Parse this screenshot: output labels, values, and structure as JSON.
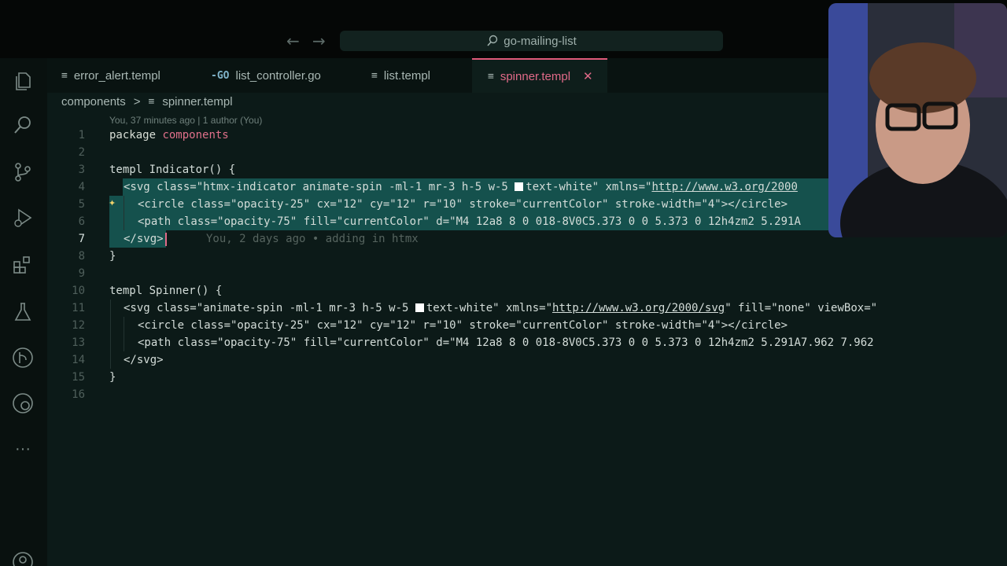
{
  "window": {
    "search_label": "go-mailing-list"
  },
  "tabs": [
    {
      "label": "error_alert.templ",
      "icon": "≡"
    },
    {
      "label": "list_controller.go",
      "icon": "-GO"
    },
    {
      "label": "list.templ",
      "icon": "≡"
    },
    {
      "label": "spinner.templ",
      "icon": "≡",
      "close": "✕"
    }
  ],
  "breadcrumb": {
    "folder": "components",
    "sep": ">",
    "file_icon": "≡",
    "file": "spinner.templ"
  },
  "blame_header": "You, 37 minutes ago | 1 author (You)",
  "inline_blame": "You, 2 days ago • adding in htmx",
  "line_numbers": [
    "1",
    "2",
    "3",
    "4",
    "5",
    "6",
    "7",
    "8",
    "9",
    "10",
    "11",
    "12",
    "13",
    "14",
    "15",
    "16"
  ],
  "code": {
    "l1a": "package ",
    "l1b": "components",
    "l3": "templ Indicator() {",
    "l4a": "<svg class=\"htmx-indicator animate-spin -ml-1 mr-3 h-5 w-5 ",
    "l4b": "text-white\" xmlns=\"",
    "l4c": "http://www.w3.org/2000",
    "l5": "<circle class=\"opacity-25\" cx=\"12\" cy=\"12\" r=\"10\" stroke=\"currentColor\" stroke-width=\"4\"></circle>",
    "l6": "<path class=\"opacity-75\" fill=\"currentColor\" d=\"M4 12a8 8 0 018-8V0C5.373 0 0 5.373 0 12h4zm2 5.291A",
    "l7": "</svg>",
    "l8": "}",
    "l10": "templ Spinner() {",
    "l11a": "<svg class=\"animate-spin -ml-1 mr-3 h-5 w-5 ",
    "l11b": "text-white\" xmlns=\"",
    "l11c": "http://www.w3.org/2000/svg",
    "l11d": "\" fill=\"none\" viewBox=\"",
    "l12": "<circle class=\"opacity-25\" cx=\"12\" cy=\"12\" r=\"10\" stroke=\"currentColor\" stroke-width=\"4\"></circle>",
    "l13": "<path class=\"opacity-75\" fill=\"currentColor\" d=\"M4 12a8 8 0 018-8V0C5.373 0 0 5.373 0 12h4zm2 5.291A7.962 7.962 ",
    "l14": "</svg>",
    "l15": "}"
  },
  "colors": {
    "accent": "#e05a7a",
    "selection": "#15514d",
    "editor_bg": "#0c1a18"
  },
  "icons": [
    "files-icon",
    "search-icon",
    "source-control-icon",
    "run-debug-icon",
    "extensions-icon",
    "testing-icon",
    "git-graph-icon",
    "remote-icon",
    "more-icon",
    "account-icon"
  ]
}
